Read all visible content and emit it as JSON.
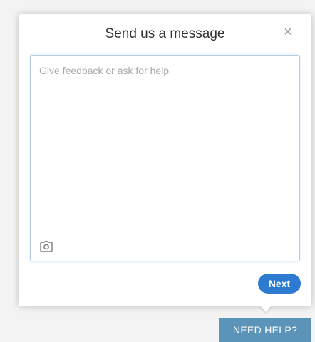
{
  "dialog": {
    "title": "Send us a message",
    "close_label": "×",
    "message_placeholder": "Give feedback or ask for help",
    "message_value": "",
    "attach_icon": "camera-icon",
    "next_label": "Next"
  },
  "help_tab": {
    "label": "NEED HELP?"
  },
  "colors": {
    "accent": "#2c7bd0",
    "help_tab": "#5b93b9",
    "input_border": "#b9cfe3"
  }
}
